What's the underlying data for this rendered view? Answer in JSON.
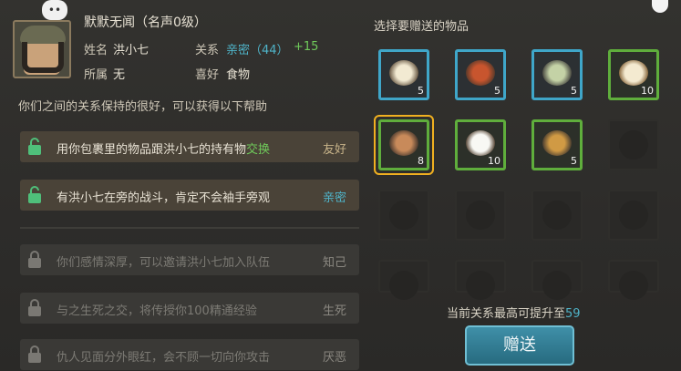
{
  "npc": {
    "bubble": "••",
    "name": "默默无闻（名声0级）",
    "name_label": "姓名",
    "name_value": "洪小七",
    "relation_label": "关系",
    "relation_value": "亲密（44）",
    "relation_bonus": "+15",
    "faction_label": "所属",
    "faction_value": "无",
    "hobby_label": "喜好",
    "hobby_value": "食物"
  },
  "info_text": "你们之间的关系保持的很好，可以获得以下帮助",
  "benefits": [
    {
      "text_pre": "用你包裹里的物品跟洪小七的持有物",
      "text_highlight": "交换",
      "tag": "友好",
      "locked": false
    },
    {
      "text_pre": "有洪小七在旁的战斗，肯定不会袖手旁观",
      "text_highlight": "",
      "tag": "亲密",
      "locked": false
    },
    {
      "text_pre": "你们感情深厚，可以邀请洪小七加入队伍",
      "text_highlight": "",
      "tag": "知己",
      "locked": true
    },
    {
      "text_pre": "与之生死之交，将传授你100精通经验",
      "text_highlight": "",
      "tag": "生死",
      "locked": true
    },
    {
      "text_pre": "仇人见面分外眼红，会不顾一切向你攻击",
      "text_highlight": "",
      "tag": "厌恶",
      "locked": true
    }
  ],
  "gift_panel": {
    "title": "选择要赠送的物品",
    "items": [
      {
        "name": "egg-soup",
        "count": "5",
        "rarity": "blue",
        "color": "#e8e0c8"
      },
      {
        "name": "meat-stew",
        "count": "5",
        "rarity": "blue",
        "color": "#b84a2a"
      },
      {
        "name": "veg-soup",
        "count": "5",
        "rarity": "blue",
        "color": "#b8c8a0"
      },
      {
        "name": "steamed-buns",
        "count": "10",
        "rarity": "green",
        "color": "#f0e6c8"
      },
      {
        "name": "fried-dish",
        "count": "8",
        "rarity": "green",
        "color": "#c07a50"
      },
      {
        "name": "rice-bowl",
        "count": "10",
        "rarity": "green",
        "color": "#f4f4f0"
      },
      {
        "name": "skewers",
        "count": "5",
        "rarity": "green",
        "color": "#c8903a"
      }
    ],
    "limit_text": "当前关系最高可提升至",
    "limit_value": "59",
    "give_button": "赠送"
  }
}
